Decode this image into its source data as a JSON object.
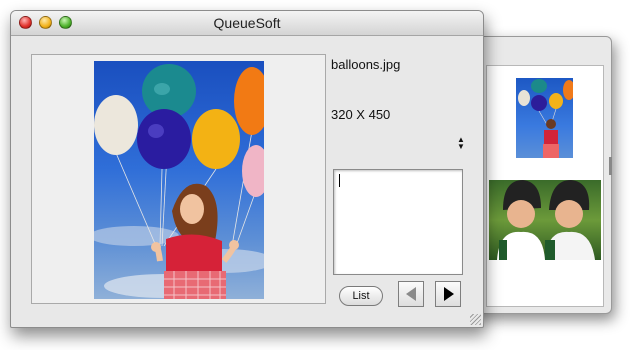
{
  "window": {
    "title": "QueueSoft"
  },
  "image": {
    "filename": "balloons.jpg",
    "dimensions": "320 X 450"
  },
  "controls": {
    "list_label": "List",
    "text_field_value": ""
  },
  "icons": {
    "close": "close-button",
    "minimize": "minimize-button",
    "zoom": "zoom-button",
    "previous": "left-triangle-arrow",
    "next": "right-triangle-arrow",
    "stepper": "up-down-arrows"
  },
  "colors": {
    "window_bg": "#e8e8e8",
    "sky_blue": "#2f6ed8"
  }
}
